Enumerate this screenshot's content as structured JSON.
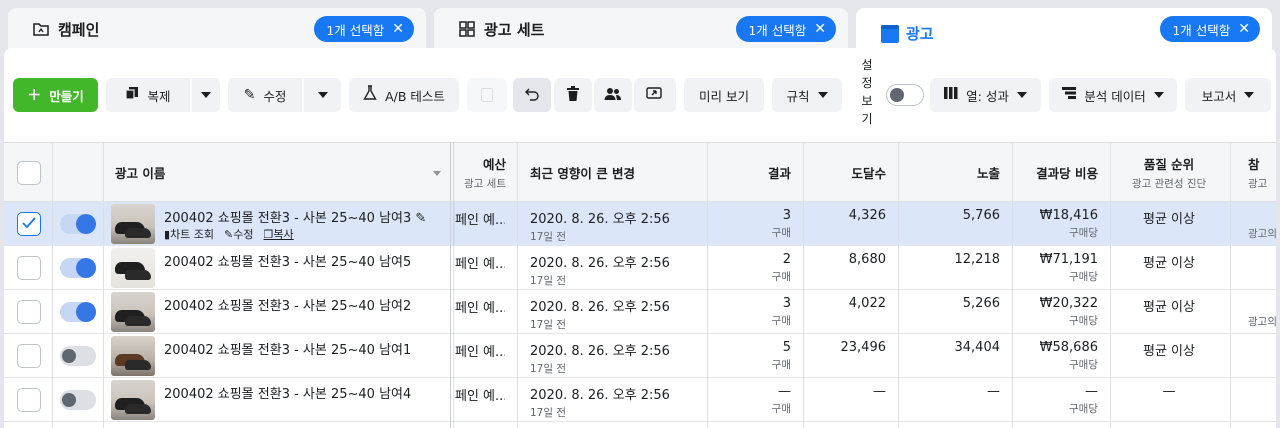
{
  "tabs": [
    {
      "label": "캠페인",
      "chip": "1개 선택함"
    },
    {
      "label": "광고 세트",
      "chip": "1개 선택함"
    },
    {
      "label": "광고",
      "chip": "1개 선택함"
    }
  ],
  "toolbar": {
    "create": "만들기",
    "duplicate": "복제",
    "edit": "수정",
    "ab_test": "A/B 테스트",
    "preview": "미리 보기",
    "rules": "규칙",
    "view_setup": [
      "설",
      "정",
      "보",
      "기"
    ],
    "columns": "열: 성과",
    "breakdown": "분석 데이터",
    "reports": "보고서"
  },
  "columns": {
    "ad_name": "광고 이름",
    "budget": "예산",
    "budget_sub": "광고 세트",
    "recent_change": "최근 영향이 큰 변경",
    "results": "결과",
    "reach": "도달수",
    "impressions": "노출",
    "cost_per_result": "결과당 비용",
    "quality": "품질 순위",
    "quality_sub": "광고 관련성 진단",
    "next": "참",
    "next_sub": "광고"
  },
  "row_actions": {
    "chart": "차트 조회",
    "edit": "수정",
    "duplicate": "복사"
  },
  "rows": [
    {
      "name": "200402 쇼핑몰 전환3 - 사본 25~40 남여3",
      "budget": "페인 예...",
      "change": "2020. 8. 26. 오후 2:56",
      "ago": "17일 전",
      "results": "3",
      "results_sub": "구매",
      "reach": "4,326",
      "impressions": "5,766",
      "cost": "₩18,416",
      "cost_sub": "구매당",
      "quality": "평균 이상",
      "next_sub": "광고의",
      "selected": true,
      "active": true
    },
    {
      "name": "200402 쇼핑몰 전환3 - 사본 25~40 남여5",
      "budget": "페인 예...",
      "change": "2020. 8. 26. 오후 2:56",
      "ago": "17일 전",
      "results": "2",
      "results_sub": "구매",
      "reach": "8,680",
      "impressions": "12,218",
      "cost": "₩71,191",
      "cost_sub": "구매당",
      "quality": "평균 이상",
      "next_sub": "",
      "selected": false,
      "active": true
    },
    {
      "name": "200402 쇼핑몰 전환3 - 사본 25~40 남여2",
      "budget": "페인 예...",
      "change": "2020. 8. 26. 오후 2:56",
      "ago": "17일 전",
      "results": "3",
      "results_sub": "구매",
      "reach": "4,022",
      "impressions": "5,266",
      "cost": "₩20,322",
      "cost_sub": "구매당",
      "quality": "평균 이상",
      "next_sub": "광고의",
      "selected": false,
      "active": true
    },
    {
      "name": "200402 쇼핑몰 전환3 - 사본 25~40 남여1",
      "budget": "페인 예...",
      "change": "2020. 8. 26. 오후 2:56",
      "ago": "17일 전",
      "results": "5",
      "results_sub": "구매",
      "reach": "23,496",
      "impressions": "34,404",
      "cost": "₩58,686",
      "cost_sub": "구매당",
      "quality": "평균 이상",
      "next_sub": "",
      "selected": false,
      "active": false
    },
    {
      "name": "200402 쇼핑몰 전환3 - 사본 25~40 남여4",
      "budget": "페인 예...",
      "change": "2020. 8. 26. 오후 2:56",
      "ago": "17일 전",
      "results": "—",
      "results_sub": "구매",
      "reach": "—",
      "impressions": "—",
      "cost": "—",
      "cost_sub": "구매당",
      "quality": "—",
      "next_sub": "",
      "selected": false,
      "active": false
    }
  ],
  "colors": {
    "accent": "#1877f2",
    "create": "#42b72a",
    "selected_row": "#dbe7f9"
  }
}
